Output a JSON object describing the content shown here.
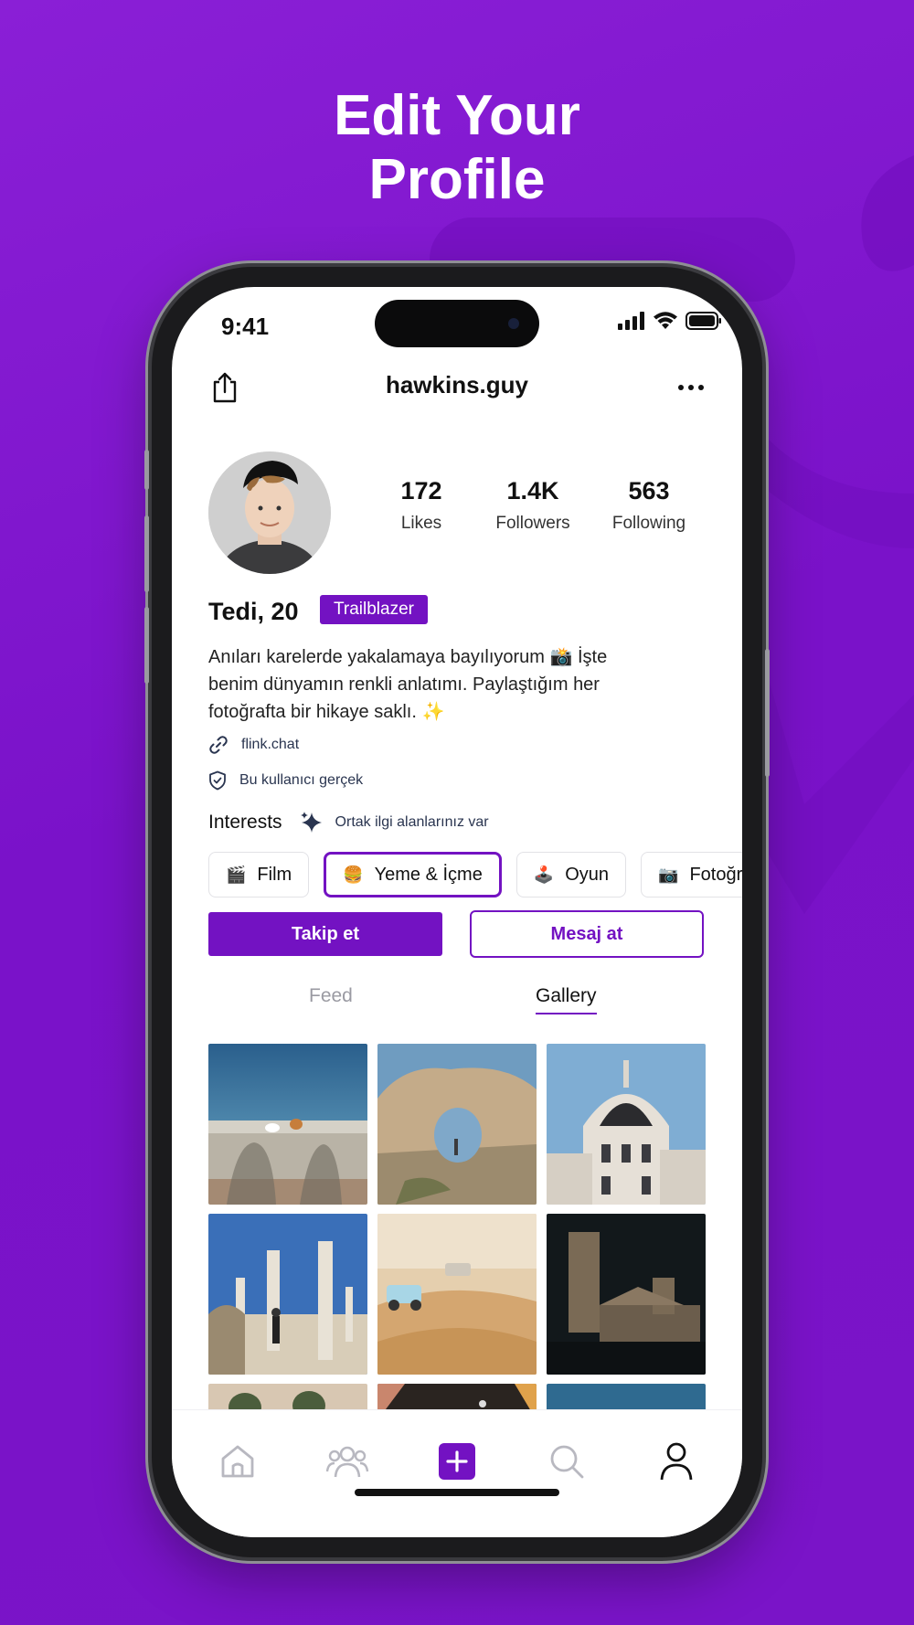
{
  "headline": [
    "Edit Your",
    "Profile"
  ],
  "colors": {
    "accent": "#7312c2",
    "background": "#7a14c8"
  },
  "status_bar": {
    "time": "9:41",
    "icons": [
      "signal-icon",
      "wifi-icon",
      "battery-icon"
    ]
  },
  "header": {
    "username": "hawkins.guy",
    "share_icon": "share-icon",
    "more_icon": "more-icon"
  },
  "profile": {
    "stats": [
      {
        "value": "172",
        "label": "Likes"
      },
      {
        "value": "1.4K",
        "label": "Followers"
      },
      {
        "value": "563",
        "label": "Following"
      }
    ],
    "name": "Tedi, 20",
    "badge": "Trailblazer",
    "bio_lines": [
      "Anıları karelerde yakalamaya bayılıyorum 📸 İşte",
      "benim dünyamın renkli anlatımı. Paylaştığım her",
      "fotoğrafta bir hikaye saklı. ✨"
    ],
    "link": "flink.chat",
    "verified": "Bu kullanıcı gerçek"
  },
  "interests": {
    "title": "Interests",
    "note": "Ortak ilgi alanlarınız var",
    "chips": [
      {
        "emoji": "🎬",
        "label": "Film",
        "selected": false
      },
      {
        "emoji": "🍔",
        "label": "Yeme & İçme",
        "selected": true
      },
      {
        "emoji": "🕹️",
        "label": "Oyun",
        "selected": false
      },
      {
        "emoji": "📷",
        "label": "Fotoğraf",
        "selected": false
      }
    ]
  },
  "actions": {
    "follow": "Takip et",
    "message": "Mesaj at"
  },
  "tabs": [
    {
      "label": "Feed",
      "active": false
    },
    {
      "label": "Gallery",
      "active": true
    }
  ],
  "gallery": {
    "photos": [
      "sea-wall-with-cat",
      "desert-rock-arch",
      "ornate-dome-building",
      "ancient-columns",
      "desert-jeeps",
      "night-stone-tower",
      "onion-domes",
      "dark-interior",
      "blue-sky"
    ]
  },
  "bottom_nav": [
    {
      "icon": "home-icon",
      "active": false
    },
    {
      "icon": "friends-icon",
      "active": false
    },
    {
      "icon": "add-icon",
      "active": false
    },
    {
      "icon": "search-icon",
      "active": false
    },
    {
      "icon": "profile-icon",
      "active": true
    }
  ]
}
